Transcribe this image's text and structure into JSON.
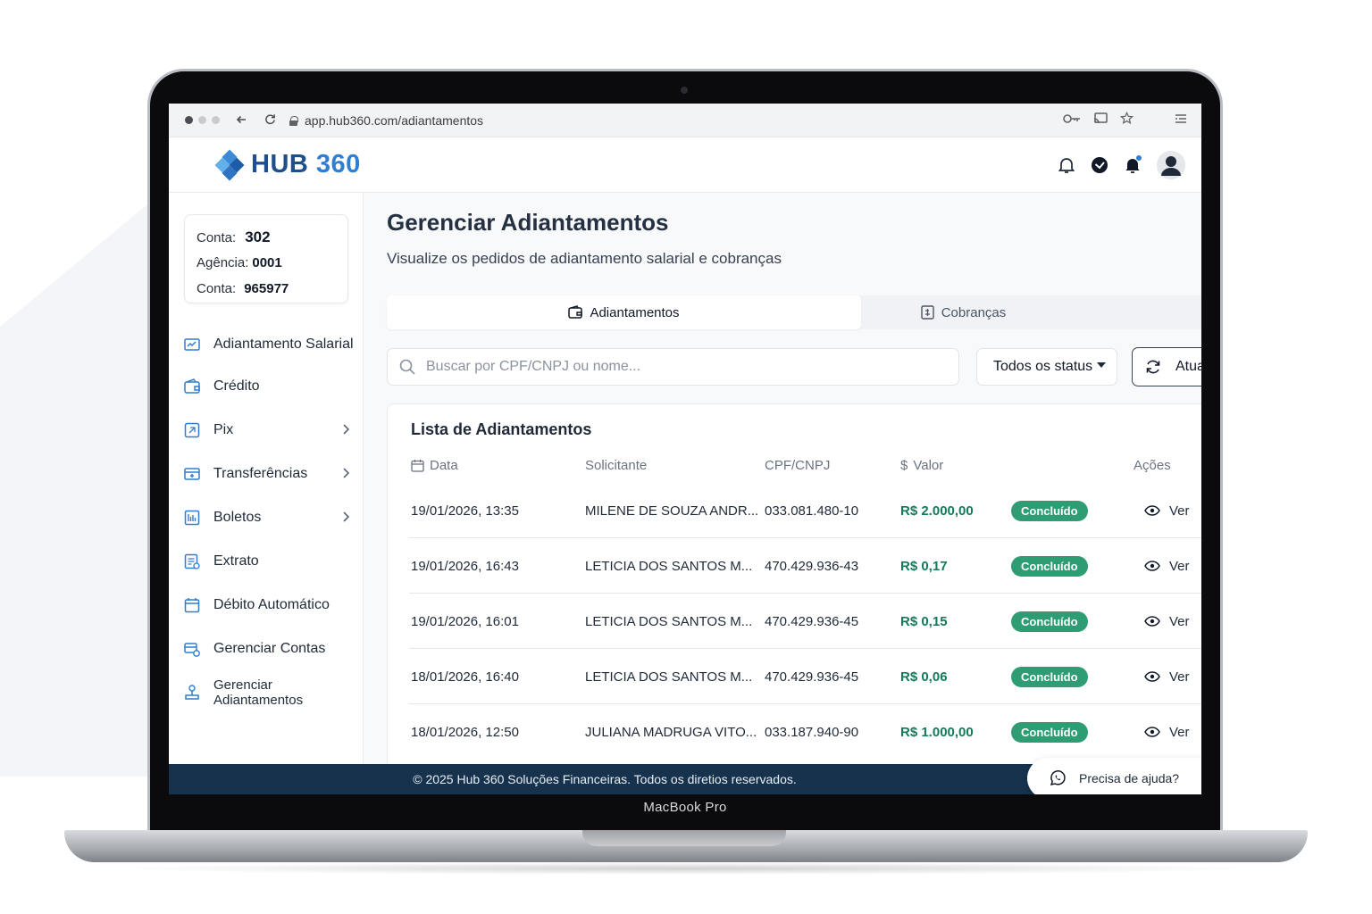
{
  "device": {
    "label": "MacBook Pro"
  },
  "browser": {
    "url": "app.hub360.com/adiantamentos"
  },
  "header": {
    "logo_text": "HUB",
    "logo_number": "360",
    "colors": {
      "brand": "#1e4f8a",
      "accent": "#2f7ed0",
      "notification_dot": "#2f7ed0"
    }
  },
  "account": {
    "rows": [
      {
        "label": "Conta:",
        "value": "302"
      },
      {
        "label": "Agência:",
        "value": "0001"
      },
      {
        "label": "Conta:",
        "value": "965977"
      }
    ]
  },
  "sidebar": {
    "items": [
      {
        "label": "Adiantamento Salarial",
        "icon": "chart-card-icon",
        "has_chevron": false
      },
      {
        "label": "Crédito",
        "icon": "wallet-icon",
        "has_chevron": false
      },
      {
        "label": "Pix",
        "icon": "pix-icon",
        "has_chevron": true
      },
      {
        "label": "Transferências",
        "icon": "transfer-icon",
        "has_chevron": true
      },
      {
        "label": "Boletos",
        "icon": "barcode-icon",
        "has_chevron": true
      },
      {
        "label": "Extrato",
        "icon": "statement-icon",
        "has_chevron": false
      },
      {
        "label": "Débito Automático",
        "icon": "calendar-icon",
        "has_chevron": false
      },
      {
        "label": "Gerenciar Contas",
        "icon": "manage-accounts-icon",
        "has_chevron": false
      },
      {
        "label": "Gerenciar Adiantamentos",
        "icon": "hand-money-icon",
        "has_chevron": false
      }
    ]
  },
  "main": {
    "title": "Gerenciar Adiantamentos",
    "subtitle": "Visualize os pedidos de adiantamento salarial e cobranças",
    "tabs": [
      {
        "label": "Adiantamentos",
        "icon": "wallet-icon",
        "active": true
      },
      {
        "label": "Cobranças",
        "icon": "receipt-icon",
        "active": false
      }
    ],
    "search": {
      "placeholder": "Buscar por CPF/CNPJ ou nome...",
      "value": ""
    },
    "status_filter": {
      "selected": "Todos os status"
    },
    "refresh_label": "Atua",
    "list": {
      "title": "Lista de Adiantamentos",
      "columns": [
        "Data",
        "Solicitante",
        "CPF/CNPJ",
        "Valor",
        "Ações"
      ],
      "rows": [
        {
          "date": "19/01/2026, 13:35",
          "name": "MILENE DE SOUZA ANDR...",
          "doc": "033.081.480-10",
          "value": "R$ 2.000,00",
          "status": "Concluído",
          "action": "Ver"
        },
        {
          "date": "19/01/2026, 16:43",
          "name": "LETICIA DOS SANTOS M...",
          "doc": "470.429.936-43",
          "value": "R$ 0,17",
          "status": "Concluído",
          "action": "Ver"
        },
        {
          "date": "19/01/2026, 16:01",
          "name": "LETICIA DOS SANTOS M...",
          "doc": "470.429.936-45",
          "value": "R$ 0,15",
          "status": "Concluído",
          "action": "Ver"
        },
        {
          "date": "18/01/2026, 16:40",
          "name": "LETICIA DOS SANTOS M...",
          "doc": "470.429.936-45",
          "value": "R$ 0,06",
          "status": "Concluído",
          "action": "Ver"
        },
        {
          "date": "18/01/2026, 12:50",
          "name": "JULIANA MADRUGA VITO...",
          "doc": "033.187.940-90",
          "value": "R$ 1.000,00",
          "status": "Concluído",
          "action": "Ver"
        }
      ]
    }
  },
  "footer": {
    "text": "© 2025 Hub 360 Soluções Financeiras. Todos os diretios reservados.",
    "help_label": "Precisa de ajuda?"
  }
}
